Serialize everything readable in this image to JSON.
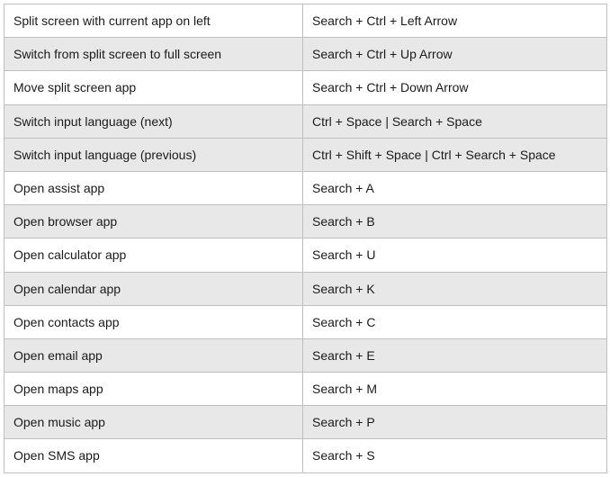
{
  "rows": [
    {
      "action": "Split screen with current app on left",
      "shortcut": "Search + Ctrl + Left Arrow"
    },
    {
      "action": "Switch from split screen to full screen",
      "shortcut": "Search + Ctrl + Up Arrow"
    },
    {
      "action": "Move split screen app",
      "shortcut": "Search + Ctrl + Down Arrow"
    },
    {
      "action": "Switch input language (next)",
      "shortcut": "Ctrl + Space | Search + Space"
    },
    {
      "action": "Switch input language (previous)",
      "shortcut": "Ctrl + Shift + Space | Ctrl + Search + Space"
    },
    {
      "action": "Open assist app",
      "shortcut": "Search + A"
    },
    {
      "action": "Open browser app",
      "shortcut": "Search + B"
    },
    {
      "action": "Open calculator app",
      "shortcut": "Search + U"
    },
    {
      "action": "Open calendar app",
      "shortcut": "Search + K"
    },
    {
      "action": "Open contacts app",
      "shortcut": "Search + C"
    },
    {
      "action": "Open email app",
      "shortcut": "Search + E"
    },
    {
      "action": "Open maps app",
      "shortcut": "Search + M"
    },
    {
      "action": "Open music app",
      "shortcut": "Search + P"
    },
    {
      "action": "Open SMS app",
      "shortcut": "Search + S"
    }
  ]
}
